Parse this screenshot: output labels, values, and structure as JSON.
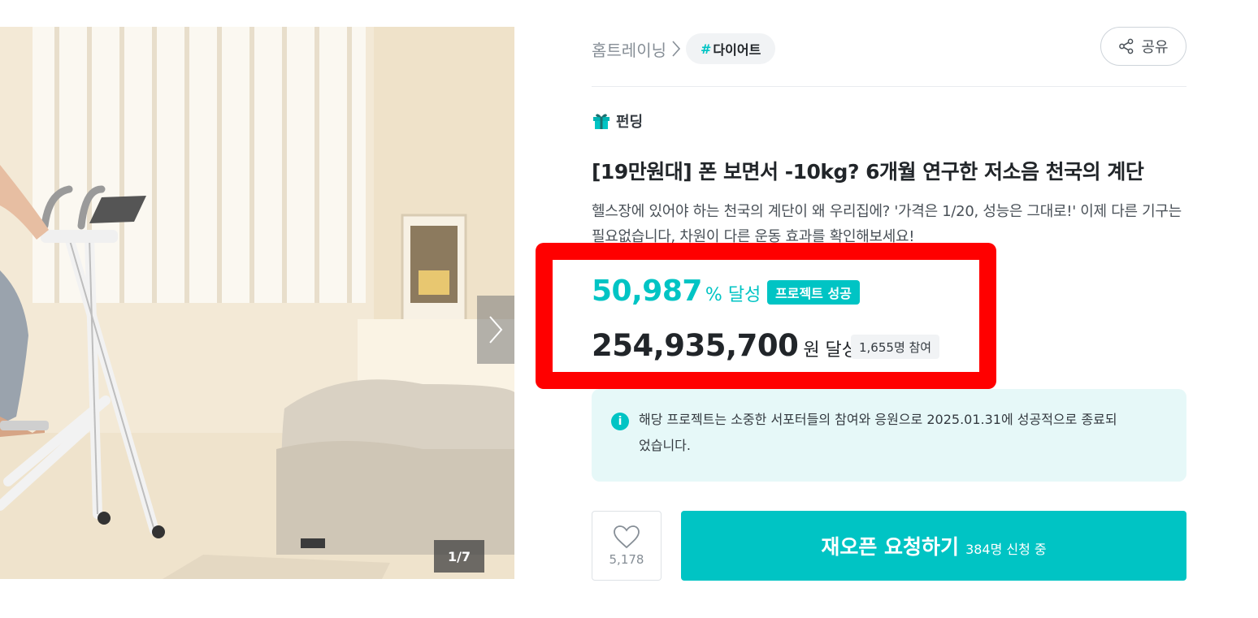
{
  "gallery": {
    "counter": "1/7"
  },
  "breadcrumb": {
    "category": "홈트레이닝",
    "tag_hash": "#",
    "tag": "다이어트"
  },
  "share": {
    "label": "공유"
  },
  "project": {
    "type": "펀딩",
    "title": "[19만원대] 폰 보면서 -10kg? 6개월 연구한 저소음 천국의 계단",
    "description": "헬스장에 있어야 하는 천국의 계단이 왜 우리집에? '가격은 1/20, 성능은 그대로!' 이제 다른 기구는 필요없습니다, 차원이 다른 운동 효과를 확인해보세요!"
  },
  "stats": {
    "achievement_rate": "50,987",
    "achievement_unit": "% 달성",
    "success_badge": "프로젝트 성공",
    "amount": "254,935,700",
    "amount_unit": "원 달성",
    "participants": "1,655명 참여"
  },
  "notice": {
    "icon": "info-icon",
    "text": "해당 프로젝트는 소중한 서포터들의 참여와 응원으로 2025.01.31에 성공적으로 종료되었습니다."
  },
  "actions": {
    "like_count": "5,178",
    "cta_label": "재오픈 요청하기",
    "cta_sub": "384명 신청 중"
  },
  "colors": {
    "accent": "#00c4c4",
    "highlight_border": "#ff0000",
    "notice_bg": "#e6f8f8"
  }
}
